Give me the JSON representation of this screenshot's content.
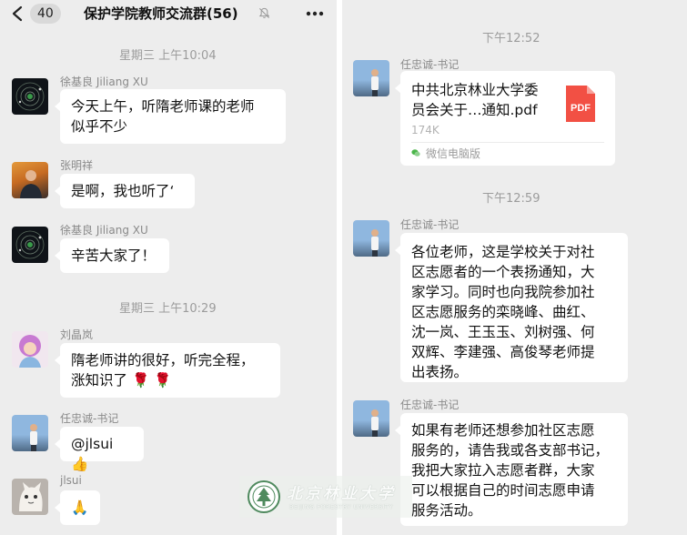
{
  "header": {
    "back_count": "40",
    "title": "保护学院教师交流群(56)"
  },
  "left_messages": {
    "t1": "星期三 上午10:04",
    "m1": {
      "sender": "徐基良 Jiliang XU",
      "lines": [
        "今天上午，听隋老师课的老师",
        "似乎不少"
      ]
    },
    "m2": {
      "sender": "张明祥",
      "text": "是啊，我也听了‘"
    },
    "m3": {
      "sender": "徐基良 Jiliang XU",
      "text": "辛苦大家了！"
    },
    "t2": "星期三 上午10:29",
    "m4": {
      "sender": "刘晶岚",
      "lines": [
        "隋老师讲的很好，听完全程，",
        "涨知识了"
      ],
      "emoji": "🌹 🌹"
    },
    "m5": {
      "sender": "任忠诚-书记",
      "text": "@jlsui",
      "emoji": "👍"
    },
    "m6": {
      "sender": "jlsui",
      "emoji": "🙏"
    }
  },
  "right_messages": {
    "t1": "下午12:52",
    "file": {
      "sender": "任忠诚-书记",
      "name_lines": [
        "中共北京林业大学委",
        "员会关于…通知.pdf"
      ],
      "size": "174K",
      "icon_label": "PDF",
      "source": "微信电脑版"
    },
    "t2": "下午12:59",
    "m2": {
      "sender": "任忠诚-书记",
      "lines": [
        "各位老师，这是学校关于对社",
        "区志愿者的一个表扬通知，大",
        "家学习。同时也向我院参加社",
        "区志愿服务的栾晓峰、曲红、",
        "沈一岚、王玉玉、刘树强、何",
        "双辉、李建强、高俊琴老师提",
        "出表扬。"
      ]
    },
    "m3": {
      "sender": "任忠诚-书记",
      "lines": [
        "如果有老师还想参加社区志愿",
        "服务的，请告我或各支部书记，",
        "我把大家拉入志愿者群，大家",
        "可以根据自己的时间志愿申请",
        "服务活动。"
      ]
    }
  },
  "watermark": {
    "script_text": "北京林业大学",
    "sub_text": "BEIJING FORESTRY UNIVERSITY"
  },
  "colors": {
    "background": "#ededed",
    "bubble": "#ffffff",
    "timestamp": "#9c9c9c",
    "sender": "#8a8a8a",
    "pdf": "#f25044"
  },
  "icons": [
    "back-chevron-icon",
    "mute-bell-icon",
    "more-icon",
    "pdf-icon",
    "wechat-icon"
  ]
}
